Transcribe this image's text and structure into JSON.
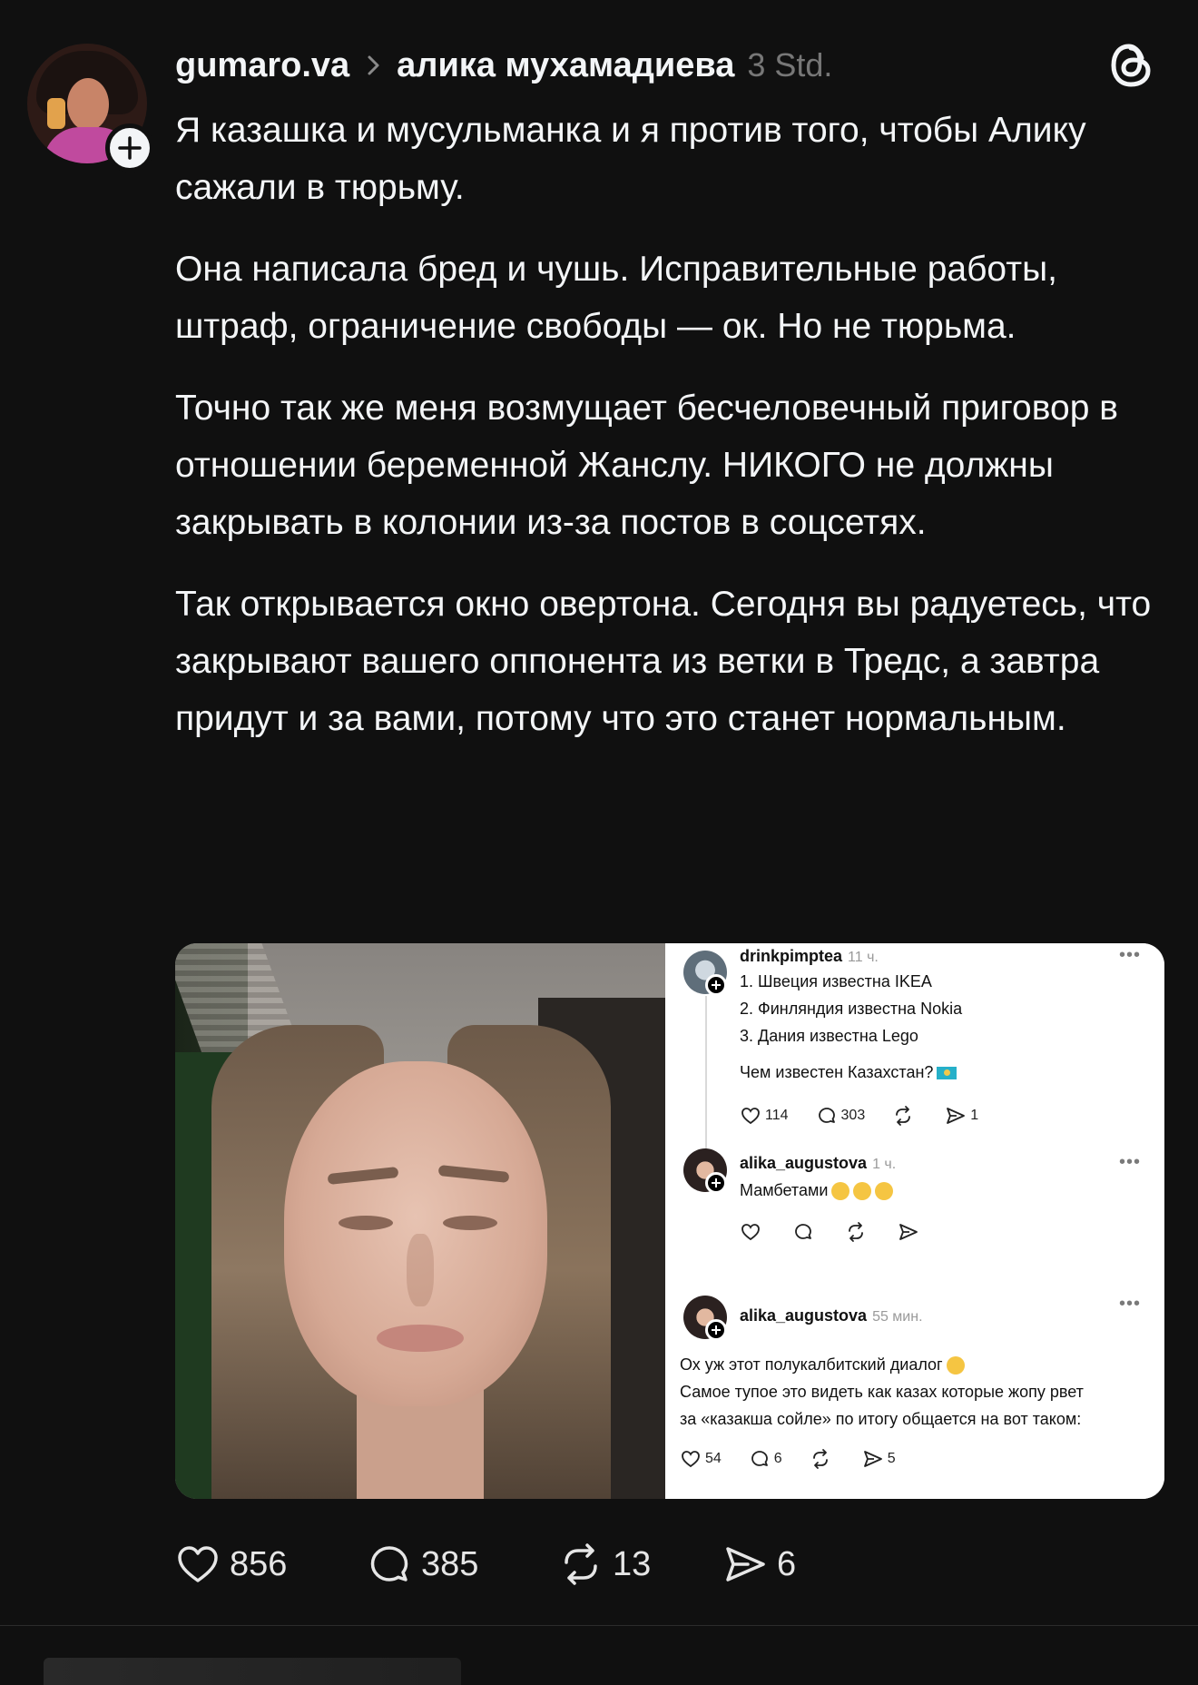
{
  "post": {
    "username": "gumaro.va",
    "reply_to": "алика мухамадиева",
    "time": "3 Std.",
    "paragraphs": [
      "Я казашка и мусульманка и я против того, чтобы Алику сажали в тюрьму.",
      "Она написала бред и чушь. Исправительные работы, штраф, ограничение свободы — ок. Но не тюрьма.",
      "Точно так же меня возмущает бесчеловечный приговор в отношении беременной Жанслу. НИКОГО не должны закрывать в колонии из-за постов в соцсетях.",
      "Так открывается окно овертона. Сегодня вы радуетесь, что закрывают вашего оппонента из ветки в Тредс, а завтра придут и за вами, потому что это станет нормальным."
    ],
    "stats": {
      "likes": "856",
      "comments": "385",
      "reposts": "13",
      "shares": "6"
    }
  },
  "embedded": {
    "post1": {
      "user": "drinkpimptea",
      "time": "11 ч.",
      "lines": [
        "1. Швеция известна IKEA",
        "2. Финляндия известна Nokia",
        "3. Дания известна Lego"
      ],
      "question": "Чем известен Казахстан?",
      "likes": "114",
      "comments": "303",
      "shares": "1"
    },
    "post2": {
      "user": "alika_augustova",
      "time": "1 ч.",
      "text": "Мамбетами"
    },
    "post3": {
      "user": "alika_augustova",
      "time": "55 мин.",
      "lines": [
        "Ох уж этот полукалбитский диалог",
        "Самое тупое это видеть как казах которые жопу рвет",
        "за «казакша сойле» по итогу общается на вот таком:"
      ],
      "likes": "54",
      "comments": "6",
      "shares": "5"
    },
    "dots": "•••"
  },
  "icons": {
    "follow": "plus-icon",
    "logo": "threads-logo-icon",
    "like": "heart-icon",
    "comment": "comment-icon",
    "repost": "repost-icon",
    "share": "send-icon"
  },
  "colors": {
    "background": "#101010",
    "text": "#f3f5f7",
    "muted": "#777777"
  }
}
